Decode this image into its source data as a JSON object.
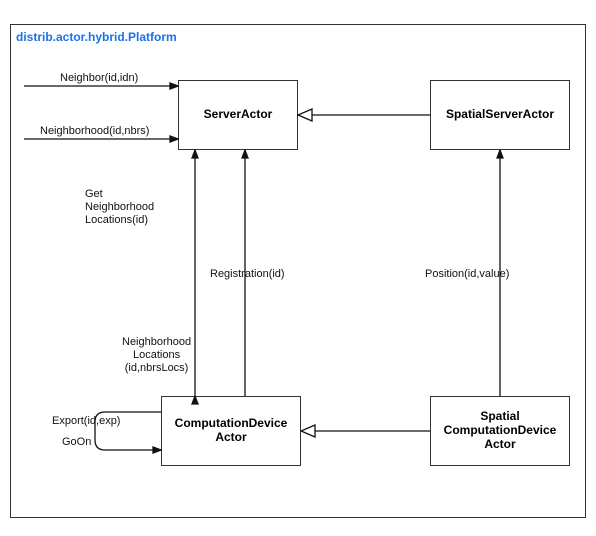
{
  "package": {
    "title": "distrib.actor.hybrid.Platform"
  },
  "classes": {
    "serverActor": "ServerActor",
    "spatialServerActor": "SpatialServerActor",
    "computationDeviceActor": "ComputationDevice\nActor",
    "spatialComputationDeviceActor": "Spatial\nComputationDevice\nActor"
  },
  "messages": {
    "neighbor": "Neighbor(id,idn)",
    "neighborhood": "Neighborhood(id,nbrs)",
    "getNeighborhoodLocations": "Get\nNeighborhood\nLocations(id)",
    "registration": "Registration(id)",
    "neighborhoodLocations": "Neighborhood\nLocations\n(id,nbrsLocs)",
    "position": "Position(id,value)",
    "export": "Export(id,exp)",
    "goOn": "GoOn"
  }
}
